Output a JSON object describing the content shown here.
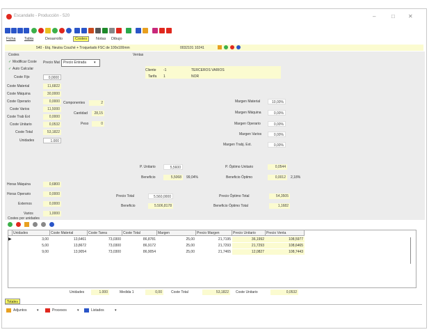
{
  "window": {
    "title": "Escandallo - Producción - 520",
    "minimize": "–",
    "restore": "□",
    "close": "✕"
  },
  "menu": [
    {
      "label": "Ficha"
    },
    {
      "label": "Tabla"
    },
    {
      "label": "Desarrollo"
    },
    {
      "label": "Costes"
    },
    {
      "label": "Notas"
    },
    {
      "label": "Dibujo"
    }
  ],
  "header": {
    "product": "540 - Etq. Neutra Couché + Troquelado FSC de 100x100mm",
    "code": "0032101 10241"
  },
  "costes": {
    "section_label": "Costes",
    "modificar_coste": "Modificar Coste",
    "auto_calcular": "Auto Calcular",
    "precio_mat_label": "Precio Mat",
    "precio_mat_value": "Precio Entrada",
    "coste_fijo_label": "Coste Fijo",
    "coste_fijo": "0,0000",
    "rows": [
      {
        "label": "Coste Material",
        "value": "11,6822"
      },
      {
        "label": "Coste Máquina",
        "value": "30,0000"
      },
      {
        "label": "Coste Operario",
        "value": "0,0000"
      },
      {
        "label": "Coste Varios",
        "value": "11,5000"
      },
      {
        "label": "Coste Trab Ext",
        "value": "0,0000"
      },
      {
        "label": "Coste Unitario",
        "value": "0,0532"
      },
      {
        "label": "Coste Total",
        "value": "53,1822"
      },
      {
        "label": "Unidades",
        "value": "1.000"
      }
    ],
    "componentes_label": "Componentes",
    "componentes": "2",
    "cantidad_label": "Cantidad",
    "cantidad": "28,15",
    "peso_label": "Peso",
    "peso": "0",
    "horas": [
      {
        "label": "Horas Máquina",
        "value": "0,6800"
      },
      {
        "label": "Horas Operario",
        "value": "0,0000"
      },
      {
        "label": "Externos",
        "value": "0,0000"
      },
      {
        "label": "Varios",
        "value": "1,0000"
      }
    ]
  },
  "ventas": {
    "section_label": "Ventas",
    "cliente_label": "Cliente",
    "cliente_code": "-1",
    "cliente_name": "TERCEROS VARIOS",
    "tarifa_label": "Tarifa",
    "tarifa_code": "1",
    "tarifa_name": "NOR",
    "margenes": [
      {
        "label": "Margen Material",
        "value": "10,00%"
      },
      {
        "label": "Margen Máquina",
        "value": "0,00%"
      },
      {
        "label": "Margen Operario",
        "value": "0,00%"
      },
      {
        "label": "Margen Varios",
        "value": "0,00%"
      },
      {
        "label": "Margen Trabj. Ext.",
        "value": "0,00%"
      }
    ],
    "p_unitario_label": "P. Unitario",
    "p_unitario": "5,5600",
    "beneficio_label": "Beneficio",
    "beneficio": "5,5068",
    "beneficio_pct": "99,04%",
    "p_optimo_label": "P. Óptimo Unitario",
    "p_optimo": "0,0544",
    "benef_optimo_label": "Beneficio Óptimo",
    "benef_optimo": "0,0012",
    "benef_optimo_pct": "2,18%",
    "precio_total_label": "Precio Total",
    "precio_total": "5.560,0000",
    "beneficio_total_label": "Beneficio",
    "beneficio_total": "5.506,8178",
    "precio_optimo_total_label": "Precio Óptimo Total",
    "precio_optimo_total": "54,3505",
    "benef_optimo_total_label": "Beneficio Óptimo Total",
    "benef_optimo_total": "1,1682"
  },
  "unidades_grid": {
    "section_label": "Costes por unidades",
    "columns": [
      "Unidades",
      "Coste Material",
      "Coste Tarea",
      "Coste Total",
      "Margen",
      "Precio Margen",
      "Precio Unitario",
      "Precio Venta"
    ],
    "rows": [
      [
        "3,00",
        "13,6461",
        "73,0300",
        "86,8781",
        "25,00",
        "21,7195",
        "36,1992",
        "108,5977"
      ],
      [
        "5,00",
        "13,8672",
        "73,0300",
        "86,9172",
        "25,00",
        "21,7293",
        "21,7293",
        "108,6465"
      ],
      [
        "9,00",
        "13,9054",
        "73,0300",
        "86,9054",
        "25,00",
        "21,7465",
        "12,0827",
        "108,7443"
      ]
    ]
  },
  "footer": {
    "unidades_label": "Unidades",
    "unidades": "1.000",
    "medida_label": "Medida 1",
    "medida": "0,00",
    "coste_total_label": "Coste Total",
    "coste_total": "53,1822",
    "coste_unitario_label": "Coste Unitario",
    "coste_unitario": "0,0532",
    "totales_label": "Totales"
  },
  "bottom_buttons": [
    {
      "label": "Adjuntos"
    },
    {
      "label": "Procesos"
    },
    {
      "label": "Listados"
    }
  ],
  "colors": {
    "yellow_field": "#fbfbd0",
    "active_tab": "#ffff66",
    "title_red": "#e0281e"
  }
}
